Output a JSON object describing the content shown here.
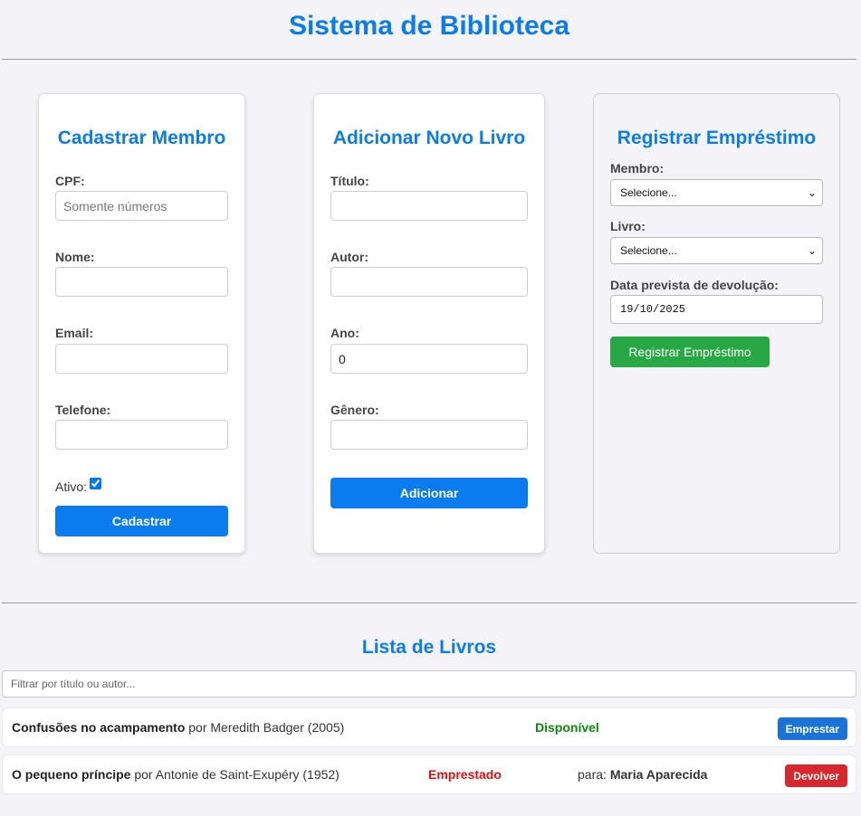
{
  "header": {
    "title": "Sistema de Biblioteca"
  },
  "member_form": {
    "title": "Cadastrar Membro",
    "cpf_label": "CPF:",
    "cpf_placeholder": "Somente números",
    "cpf_value": "",
    "name_label": "Nome:",
    "name_value": "",
    "email_label": "Email:",
    "email_value": "",
    "phone_label": "Telefone:",
    "phone_value": "",
    "active_label": "Ativo:",
    "active_checked": true,
    "submit_label": "Cadastrar"
  },
  "book_form": {
    "title": "Adicionar Novo Livro",
    "title_label": "Título:",
    "title_value": "",
    "author_label": "Autor:",
    "author_value": "",
    "year_label": "Ano:",
    "year_value": "0",
    "genre_label": "Gênero:",
    "genre_value": "",
    "submit_label": "Adicionar"
  },
  "loan_form": {
    "title": "Registrar Empréstimo",
    "member_label": "Membro:",
    "member_selected": "Selecione...",
    "book_label": "Livro:",
    "book_selected": "Selecione...",
    "due_label": "Data prevista de devolução:",
    "due_value": "19/10/2025",
    "submit_label": "Registrar Empréstimo"
  },
  "book_list": {
    "title": "Lista de Livros",
    "filter_placeholder": "Filtrar por título ou autor...",
    "items": [
      {
        "title": "Confusões no acampamento",
        "by": "por",
        "author": "Meredith Badger",
        "year": "(2005)",
        "status": "Disponível",
        "status_color": "#0a8a0a",
        "action": "Emprestar",
        "action_color": "#1a73d9"
      },
      {
        "title": "O pequeno príncipe",
        "by": "por",
        "author": "Antonie de Saint-Exupéry",
        "year": "(1952)",
        "status": "Emprestado",
        "status_color": "#e01010",
        "borrower_prefix": "para:",
        "borrower": "Maria Aparecida",
        "action": "Devolver",
        "action_color": "#d9272e"
      }
    ]
  },
  "colors": {
    "accent": "#0b7bf0",
    "success": "#28a745"
  }
}
